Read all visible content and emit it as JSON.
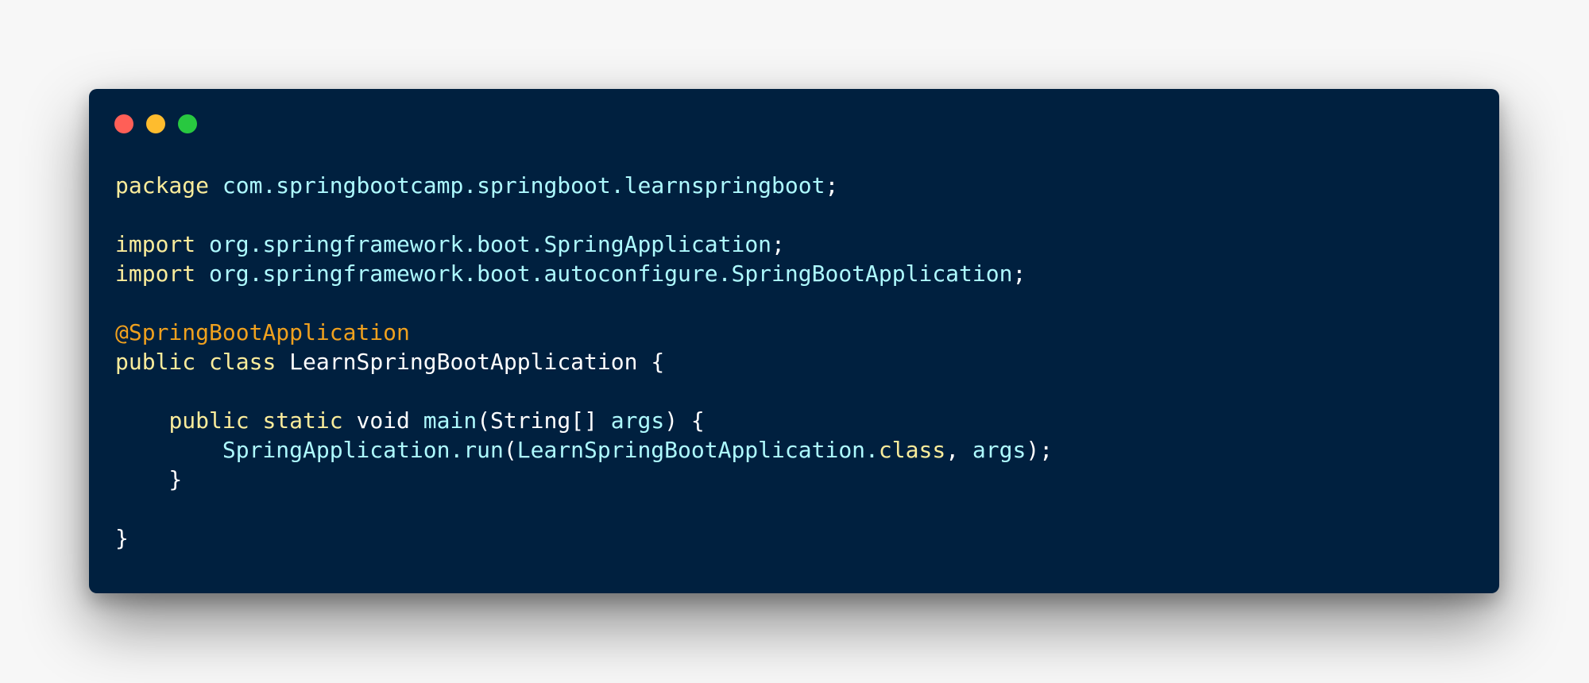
{
  "window": {
    "controls": [
      {
        "name": "close",
        "color": "#ff5f57"
      },
      {
        "name": "minimize",
        "color": "#febc2e"
      },
      {
        "name": "maximize",
        "color": "#28c840"
      }
    ]
  },
  "colors": {
    "background": "#00203f",
    "keyword": "#faec9b",
    "identifier": "#aefaff",
    "annotation": "#f0a11e",
    "plain": "#ffffff"
  },
  "code": {
    "language": "java",
    "lines": [
      [
        {
          "text": "package",
          "type": "keyword"
        },
        {
          "text": " ",
          "type": "plain"
        },
        {
          "text": "com.springbootcamp.springboot.learnspringboot",
          "type": "ident"
        },
        {
          "text": ";",
          "type": "plain"
        }
      ],
      [],
      [
        {
          "text": "import",
          "type": "keyword"
        },
        {
          "text": " ",
          "type": "plain"
        },
        {
          "text": "org.springframework.boot.SpringApplication",
          "type": "ident"
        },
        {
          "text": ";",
          "type": "plain"
        }
      ],
      [
        {
          "text": "import",
          "type": "keyword"
        },
        {
          "text": " ",
          "type": "plain"
        },
        {
          "text": "org.springframework.boot.autoconfigure.SpringBootApplication",
          "type": "ident"
        },
        {
          "text": ";",
          "type": "plain"
        }
      ],
      [],
      [
        {
          "text": "@SpringBootApplication",
          "type": "annotation"
        }
      ],
      [
        {
          "text": "public",
          "type": "keyword"
        },
        {
          "text": " ",
          "type": "plain"
        },
        {
          "text": "class",
          "type": "keyword"
        },
        {
          "text": " LearnSpringBootApplication {",
          "type": "plain"
        }
      ],
      [],
      [
        {
          "text": "    ",
          "type": "plain"
        },
        {
          "text": "public",
          "type": "keyword"
        },
        {
          "text": " ",
          "type": "plain"
        },
        {
          "text": "static",
          "type": "keyword"
        },
        {
          "text": " void ",
          "type": "plain"
        },
        {
          "text": "main",
          "type": "ident"
        },
        {
          "text": "(String[] ",
          "type": "plain"
        },
        {
          "text": "args",
          "type": "ident"
        },
        {
          "text": ") {",
          "type": "plain"
        }
      ],
      [
        {
          "text": "        ",
          "type": "plain"
        },
        {
          "text": "SpringApplication.run",
          "type": "ident"
        },
        {
          "text": "(",
          "type": "plain"
        },
        {
          "text": "LearnSpringBootApplication.",
          "type": "ident"
        },
        {
          "text": "class",
          "type": "keyword"
        },
        {
          "text": ", ",
          "type": "plain"
        },
        {
          "text": "args",
          "type": "ident"
        },
        {
          "text": ");",
          "type": "plain"
        }
      ],
      [
        {
          "text": "    }",
          "type": "plain"
        }
      ],
      [],
      [
        {
          "text": "}",
          "type": "plain"
        }
      ]
    ]
  }
}
